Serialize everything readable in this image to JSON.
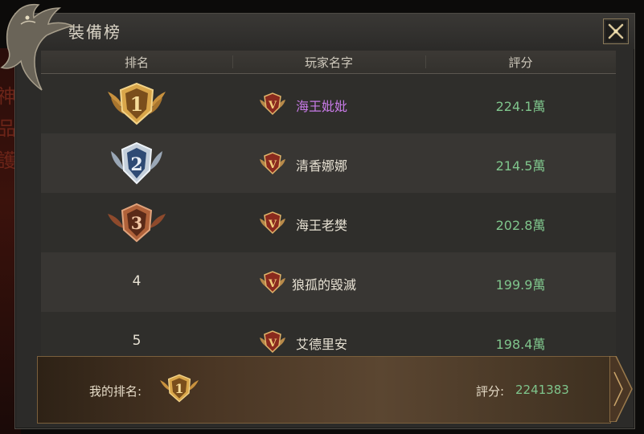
{
  "window": {
    "title": "裝備榜"
  },
  "table": {
    "headers": {
      "rank": "排名",
      "name": "玩家名字",
      "score": "評分"
    },
    "rows": [
      {
        "rank": "1",
        "medal": "gold",
        "name": "海王妣妣",
        "name_color": "#c77ae6",
        "score": "224.1萬"
      },
      {
        "rank": "2",
        "medal": "silver",
        "name": "清香娜娜",
        "name_color": "#e6e0d2",
        "score": "214.5萬"
      },
      {
        "rank": "3",
        "medal": "bronze",
        "name": "海王老樊",
        "name_color": "#e6e0d2",
        "score": "202.8萬"
      },
      {
        "rank": "4",
        "medal": "none",
        "name": "狼孤的毀滅",
        "name_color": "#e6e0d2",
        "score": "199.9萬"
      },
      {
        "rank": "5",
        "medal": "none",
        "name": "艾德里安",
        "name_color": "#e6e0d2",
        "score": "198.4萬"
      }
    ]
  },
  "my_rank": {
    "label": "我的排名:",
    "rank": "1",
    "score_label": "評分:",
    "score": "2241383"
  },
  "icons": {
    "close": "close-x-icon",
    "vip": "vip-crown-badge-icon",
    "medal": "rank-medal-icon",
    "logo": "dragon-emblem-icon"
  },
  "colors": {
    "gold": "#d9a64a",
    "silver": "#9fb2c9",
    "bronze": "#b0623a",
    "score_green": "#7fc58c",
    "purple_name": "#c77ae6"
  }
}
